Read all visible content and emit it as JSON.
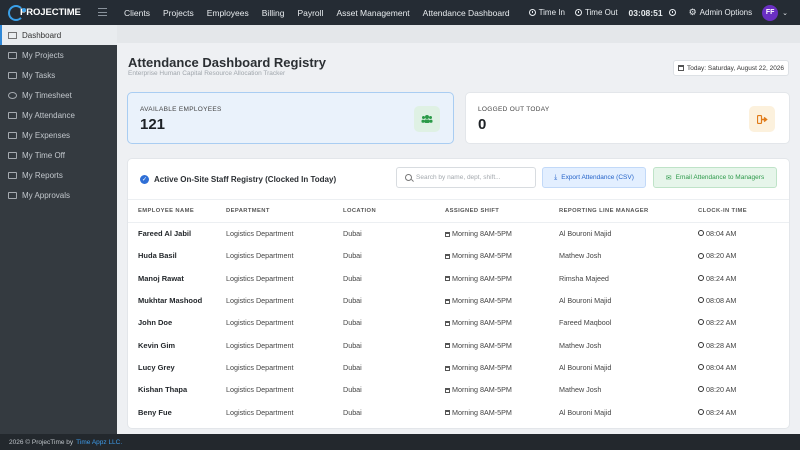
{
  "app": {
    "logo_text": "PROJECTIME"
  },
  "topnav": {
    "items": [
      "Clients",
      "Projects",
      "Employees",
      "Billing",
      "Payroll",
      "Asset Management",
      "Attendance Dashboard"
    ],
    "time_in": "Time In",
    "time_out": "Time Out",
    "timer": "03:08:51",
    "admin": "Admin Options",
    "avatar_initials": "FF",
    "avatar_color": "#6a2fc2"
  },
  "sidebar": {
    "items": [
      {
        "label": "Dashboard",
        "icon": "home-icon",
        "active": true
      },
      {
        "label": "My Projects",
        "icon": "folder-icon"
      },
      {
        "label": "My Tasks",
        "icon": "tasks-icon"
      },
      {
        "label": "My Timesheet",
        "icon": "clock-icon"
      },
      {
        "label": "My Attendance",
        "icon": "attendance-icon"
      },
      {
        "label": "My Expenses",
        "icon": "expenses-icon"
      },
      {
        "label": "My Time Off",
        "icon": "calendar-icon"
      },
      {
        "label": "My Reports",
        "icon": "reports-icon"
      },
      {
        "label": "My Approvals",
        "icon": "approvals-icon"
      }
    ]
  },
  "page": {
    "title": "Attendance Dashboard Registry",
    "subtitle": "Enterprise Human Capital Resource Allocation Tracker",
    "date": "Today: Saturday, August 22, 2026"
  },
  "cards": {
    "available_label": "AVAILABLE EMPLOYEES",
    "available_value": "121",
    "logged_out_label": "LOGGED OUT TODAY",
    "logged_out_value": "0"
  },
  "panel": {
    "title": "Active On-Site Staff Registry (Clocked In Today)",
    "search_placeholder": "Search by name, dept, shift...",
    "export_label": "Export Attendance (CSV)",
    "email_label": "Email Attendance to Managers",
    "columns": [
      "EMPLOYEE NAME",
      "DEPARTMENT",
      "LOCATION",
      "ASSIGNED SHIFT",
      "REPORTING LINE MANAGER",
      "CLOCK-IN TIME"
    ],
    "rows": [
      {
        "name": "Fareed Al Jabil",
        "department": "Logistics Department",
        "location": "Dubai",
        "shift": "Morning 8AM-5PM",
        "manager": "Al Bouroni Majid",
        "clock_in": "08:04 AM"
      },
      {
        "name": "Huda Basil",
        "department": "Logistics Department",
        "location": "Dubai",
        "shift": "Morning 8AM-5PM",
        "manager": "Mathew Josh",
        "clock_in": "08:20 AM"
      },
      {
        "name": "Manoj Rawat",
        "department": "Logistics Department",
        "location": "Dubai",
        "shift": "Morning 8AM-5PM",
        "manager": "Rimsha Majeed",
        "clock_in": "08:24 AM"
      },
      {
        "name": "Mukhtar Mashood",
        "department": "Logistics Department",
        "location": "Dubai",
        "shift": "Morning 8AM-5PM",
        "manager": "Al Bouroni Majid",
        "clock_in": "08:08 AM"
      },
      {
        "name": "John Doe",
        "department": "Logistics Department",
        "location": "Dubai",
        "shift": "Morning 8AM-5PM",
        "manager": "Fareed Maqbool",
        "clock_in": "08:22 AM"
      },
      {
        "name": "Kevin Gim",
        "department": "Logistics Department",
        "location": "Dubai",
        "shift": "Morning 8AM-5PM",
        "manager": "Mathew Josh",
        "clock_in": "08:28 AM"
      },
      {
        "name": "Lucy Grey",
        "department": "Logistics Department",
        "location": "Dubai",
        "shift": "Morning 8AM-5PM",
        "manager": "Al Bouroni Majid",
        "clock_in": "08:04 AM"
      },
      {
        "name": "Kishan Thapa",
        "department": "Logistics Department",
        "location": "Dubai",
        "shift": "Morning 8AM-5PM",
        "manager": "Mathew Josh",
        "clock_in": "08:20 AM"
      },
      {
        "name": "Beny Fue",
        "department": "Logistics Department",
        "location": "Dubai",
        "shift": "Morning 8AM-5PM",
        "manager": "Al Bouroni Majid",
        "clock_in": "08:24 AM"
      }
    ]
  },
  "footer": {
    "text": "2026 © ProjecTime by",
    "link": "Time Appz LLC."
  }
}
